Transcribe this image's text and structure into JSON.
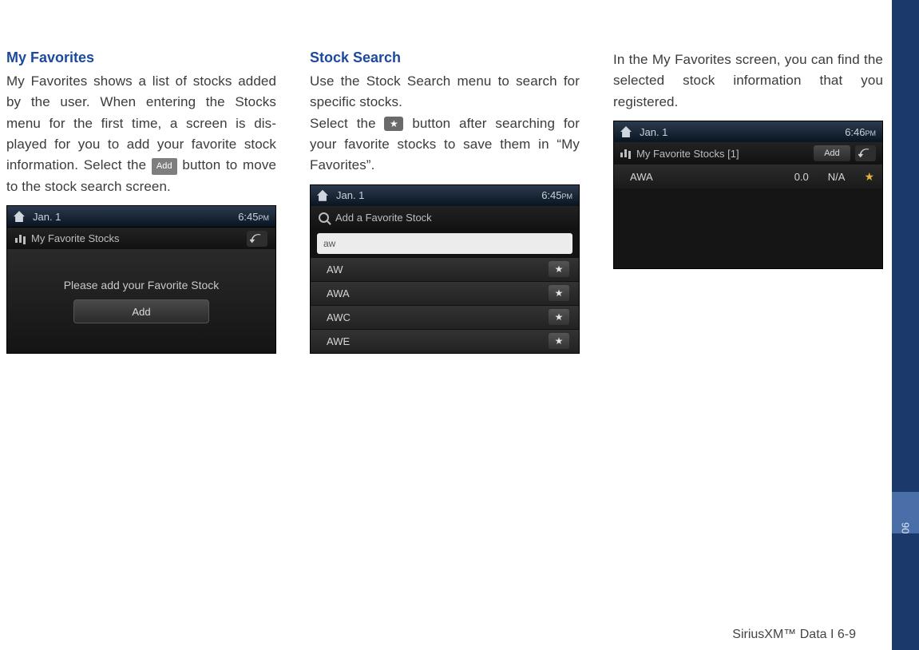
{
  "col1": {
    "heading": "My Favorites",
    "para_a": "My Favorites shows a list of stocks added by the user. When entering the Stocks menu for the first time, a screen is dis-played for you to add your favorite stock information. Select the ",
    "add_btn": "Add",
    "para_b": " button to move to the stock search screen.",
    "shot": {
      "date": "Jan. 1",
      "time": "6:45",
      "ampm": "PM",
      "subbar": "My Favorite Stocks",
      "msg": "Please add your Favorite Stock",
      "add": "Add"
    }
  },
  "col2": {
    "heading": "Stock Search",
    "para_a": "Use the Stock Search menu to search for specific stocks.",
    "para_b_pre": "Select the ",
    "star": "★",
    "para_b_post": " button after searching for your favorite stocks to save them in “My Favorites”.",
    "shot": {
      "date": "Jan. 1",
      "time": "6:45",
      "ampm": "PM",
      "search_label": "Add a Favorite Stock",
      "input": "aw",
      "rows": [
        "AW",
        "AWA",
        "AWC",
        "AWE"
      ]
    }
  },
  "col3": {
    "para": "In the My Favorites screen, you can find the selected stock information that you registered.",
    "shot": {
      "date": "Jan. 1",
      "time": "6:46",
      "ampm": "PM",
      "subbar": "My Favorite Stocks [1]",
      "add": "Add",
      "row": {
        "sym": "AWA",
        "val": "0.0",
        "na": "N/A"
      }
    }
  },
  "side_tab": "06",
  "footer": "SiriusXM™ Data I 6-9"
}
